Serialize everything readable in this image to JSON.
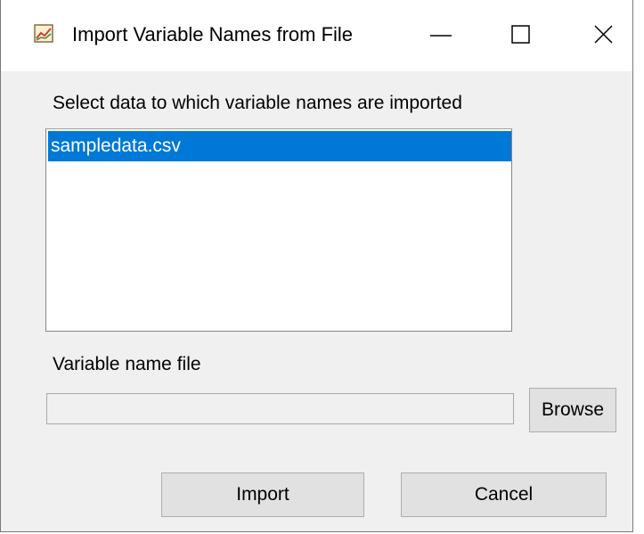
{
  "window": {
    "title": "Import Variable Names from File",
    "app_icon": "chart-app-icon",
    "controls": [
      "minimize-icon",
      "maximize-icon",
      "close-icon"
    ]
  },
  "data_select": {
    "label": "Select data to which variable names are imported",
    "items": [
      "sampledata.csv"
    ],
    "selected_index": 0
  },
  "variable_file": {
    "label": "Variable name file",
    "value": "",
    "browse_label": "Browse"
  },
  "actions": {
    "import_label": "Import",
    "cancel_label": "Cancel"
  },
  "colors": {
    "selection": "#0078d7",
    "dialog_bg": "#f0f0f0",
    "button_bg": "#e1e1e1"
  }
}
